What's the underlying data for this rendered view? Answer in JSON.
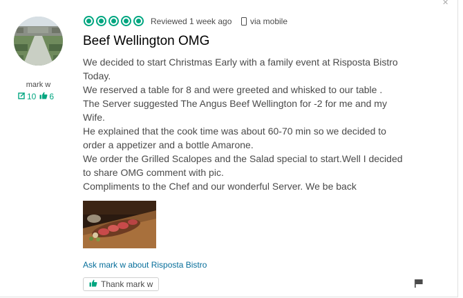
{
  "member": {
    "username": "mark w",
    "reviews_count": "10",
    "helpful_votes": "6"
  },
  "review": {
    "rating": 5,
    "max_rating": 5,
    "reviewed_text": "Reviewed 1 week ago",
    "via_text": "via mobile",
    "title": "Beef Wellington OMG",
    "paragraphs": [
      "We decided to start Christmas Early with a family event at Risposta Bistro Today.",
      "We reserved a table for 8 and were greeted and whisked to our table .",
      "The Server suggested The Angus Beef Wellington for -2 for me and my Wife.",
      "He explained that the cook time was about 60-70 min so we decided to order a appetizer and a bottle Amarone.",
      "We order the Grilled Scalopes and the Salad special to start.Well I decided to share OMG comment with pic.",
      "Compliments to the Chef and our wonderful Server. We be back"
    ]
  },
  "actions": {
    "ask_link": "Ask mark w about Risposta Bistro",
    "thank_button": "Thank mark w"
  },
  "colors": {
    "brand_green": "#00a680",
    "link_blue": "#066e9a",
    "title": "#000000",
    "text": "#4a4a4a"
  },
  "icons": {
    "corner": "close-icon",
    "reviews": "review-count-icon",
    "votes": "thumbs-up-icon",
    "mobile": "mobile-phone-icon",
    "report": "flag-icon"
  }
}
